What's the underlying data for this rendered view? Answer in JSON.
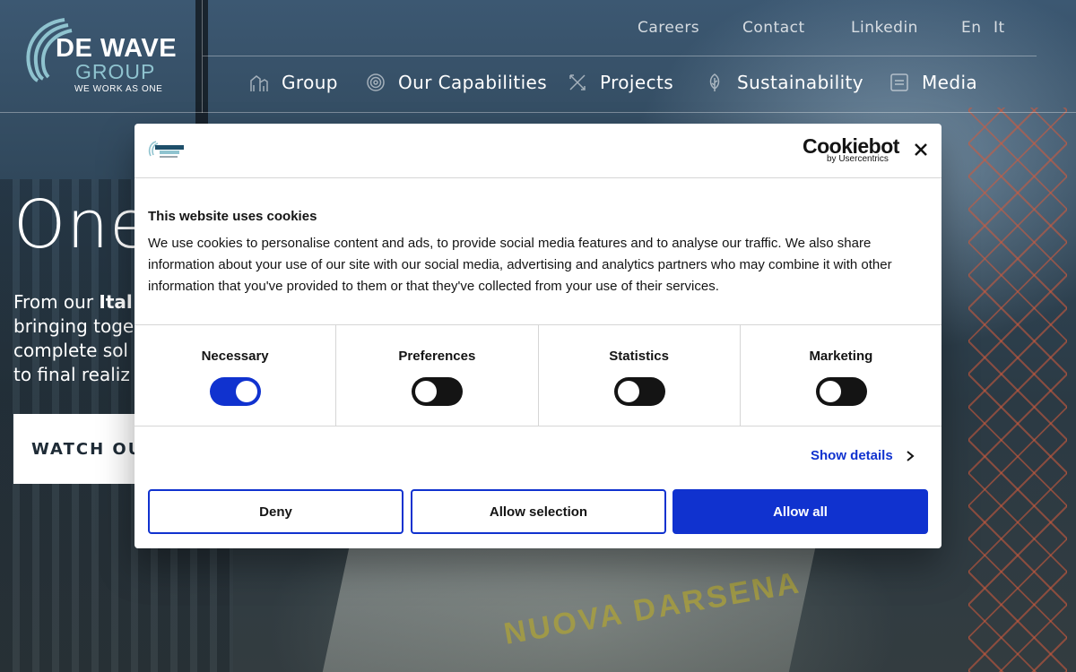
{
  "brand": {
    "name": "DE WAVE",
    "sub": "GROUP",
    "tagline": "WE WORK AS ONE"
  },
  "top_links": [
    {
      "label": "Careers"
    },
    {
      "label": "Contact"
    },
    {
      "label": "Linkedin"
    },
    {
      "label": "En"
    },
    {
      "label": "It"
    }
  ],
  "nav": [
    {
      "label": "Group",
      "icon": "buildings-icon"
    },
    {
      "label": "Our Capabilities",
      "icon": "target-icon"
    },
    {
      "label": "Projects",
      "icon": "tools-icon"
    },
    {
      "label": "Sustainability",
      "icon": "leaf-icon"
    },
    {
      "label": "Media",
      "icon": "document-icon"
    }
  ],
  "hero": {
    "title_visible": "One",
    "text_lines": [
      "From our Ital",
      "bringing toge",
      "complete sol",
      "to final realiz"
    ],
    "text_bold": "Ital",
    "cta_label": "WATCH OU",
    "building_sign": "NUOVA DARSENA"
  },
  "cookie": {
    "brand_main": "Cookiebot",
    "brand_sub": "by Usercentrics",
    "title": "This website uses cookies",
    "body": "We use cookies to personalise content and ads, to provide social media features and to analyse our traffic. We also share information about your use of our site with our social media, advertising and analytics partners who may combine it with other information that you've provided to them or that they've collected from your use of their services.",
    "toggles": [
      {
        "label": "Necessary",
        "on": true
      },
      {
        "label": "Preferences",
        "on": false
      },
      {
        "label": "Statistics",
        "on": false
      },
      {
        "label": "Marketing",
        "on": false
      }
    ],
    "show_details": "Show details",
    "buttons": {
      "deny": "Deny",
      "allow_selection": "Allow selection",
      "allow_all": "Allow all"
    },
    "colors": {
      "accent": "#1032cf",
      "toggle_off": "#141414"
    }
  }
}
